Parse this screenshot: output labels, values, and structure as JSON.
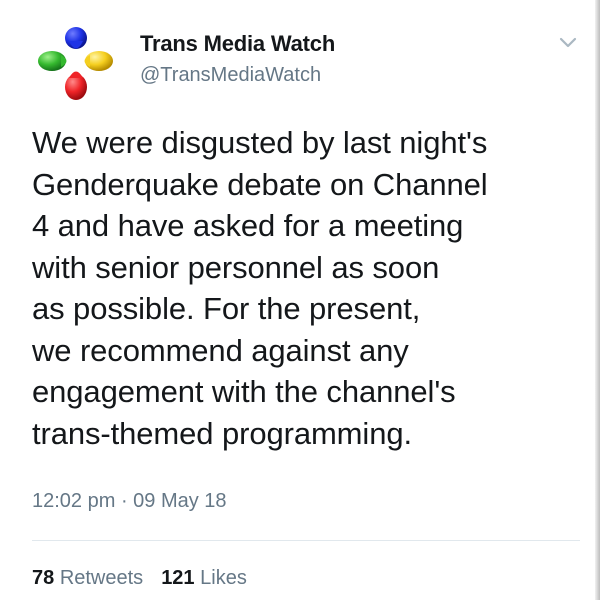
{
  "author": {
    "display_name": "Trans Media Watch",
    "handle": "@TransMediaWatch",
    "avatar_icon": "four-color-pin-logo-icon"
  },
  "tweet": {
    "text": "We were disgusted by last night's\nGenderquake debate on Channel\n4 and have asked for a meeting\nwith senior personnel as soon\nas possible. For the present,\nwe recommend against any\nengagement with the channel's\ntrans-themed programming.",
    "timestamp": "12:02 pm · 09 May 18"
  },
  "stats": {
    "retweets_count": "78",
    "retweets_label": "Retweets",
    "likes_count": "121",
    "likes_label": "Likes"
  },
  "colors": {
    "text_primary": "#14171a",
    "text_secondary": "#657786",
    "divider": "#e1e8ed",
    "logo_blue": "#1f33e6",
    "logo_red": "#ef2428",
    "logo_green": "#35b92f",
    "logo_yellow": "#f5cf1f"
  }
}
